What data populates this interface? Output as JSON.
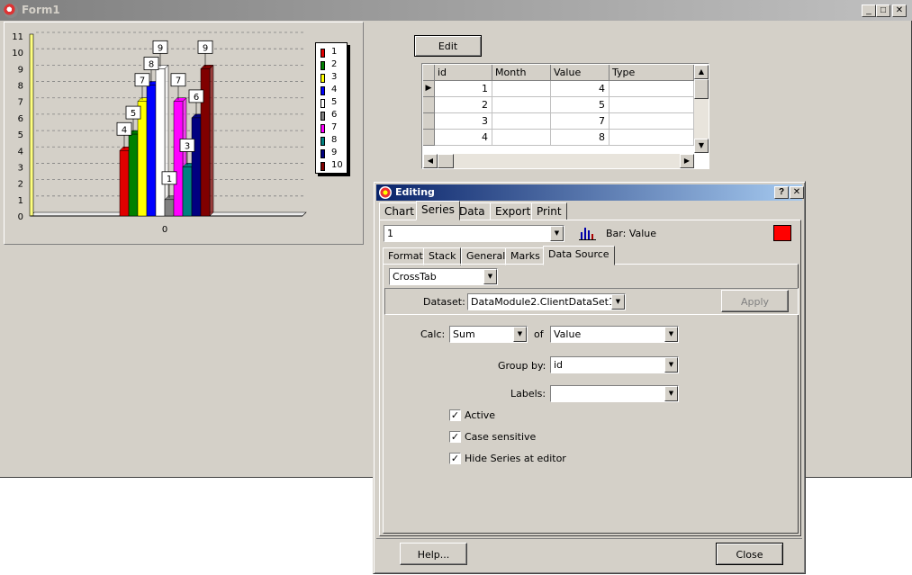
{
  "form": {
    "title": "Form1",
    "minimize_glyph": "_",
    "maximize_glyph": "□",
    "close_glyph": "✕"
  },
  "chart_data": {
    "type": "bar",
    "categories": [
      "0"
    ],
    "series": [
      {
        "name": "1",
        "values": [
          4
        ],
        "color": "#e00000"
      },
      {
        "name": "2",
        "values": [
          5
        ],
        "color": "#008000"
      },
      {
        "name": "3",
        "values": [
          7
        ],
        "color": "#ffff00"
      },
      {
        "name": "4",
        "values": [
          8
        ],
        "color": "#0000ff"
      },
      {
        "name": "5",
        "values": [
          9
        ],
        "color": "#ffffff"
      },
      {
        "name": "6",
        "values": [
          1
        ],
        "color": "#808080"
      },
      {
        "name": "7",
        "values": [
          7
        ],
        "color": "#ff00ff"
      },
      {
        "name": "8",
        "values": [
          3
        ],
        "color": "#008080"
      },
      {
        "name": "9",
        "values": [
          6
        ],
        "color": "#000080"
      },
      {
        "name": "10",
        "values": [
          9
        ],
        "color": "#800000"
      }
    ],
    "y_ticks": [
      "0",
      "1",
      "2",
      "3",
      "4",
      "5",
      "6",
      "7",
      "8",
      "9",
      "10",
      "11"
    ],
    "ylim": [
      0,
      11
    ],
    "grid": true,
    "legend_position": "right",
    "data_labels": true
  },
  "edit_button": {
    "label": "Edit"
  },
  "grid": {
    "columns": [
      "id",
      "Month",
      "Value",
      "Type"
    ],
    "rows": [
      {
        "id": "1",
        "month": "",
        "value": "4",
        "type": ""
      },
      {
        "id": "2",
        "month": "",
        "value": "5",
        "type": ""
      },
      {
        "id": "3",
        "month": "",
        "value": "7",
        "type": ""
      },
      {
        "id": "4",
        "month": "",
        "value": "8",
        "type": ""
      }
    ],
    "current_row_marker": "▶"
  },
  "dialog": {
    "title": "Editing",
    "help_glyph": "?",
    "close_glyph": "✕",
    "tabs": [
      "Chart",
      "Series",
      "Data",
      "Export",
      "Print"
    ],
    "active_tab": "Series",
    "series_combo": "1",
    "series_info": "Bar: Value",
    "series_color": "#ff0000",
    "subtabs": [
      "Format",
      "Stack",
      "General",
      "Marks",
      "Data Source"
    ],
    "active_subtab": "Data Source",
    "source_combo": "CrossTab",
    "dataset_label": "Dataset:",
    "dataset_value": "DataModule2.ClientDataSet1",
    "apply_label": "Apply",
    "calc_label": "Calc:",
    "calc_value": "Sum",
    "of_label": "of",
    "of_value": "Value",
    "groupby_label": "Group by:",
    "groupby_value": "id",
    "labels_label": "Labels:",
    "labels_value": "",
    "checkboxes": [
      {
        "label": "Active",
        "checked": true
      },
      {
        "label": "Case sensitive",
        "checked": true
      },
      {
        "label": "Hide Series at editor",
        "checked": true
      }
    ],
    "check_glyph": "✓",
    "help_button": "Help...",
    "close_button": "Close"
  }
}
